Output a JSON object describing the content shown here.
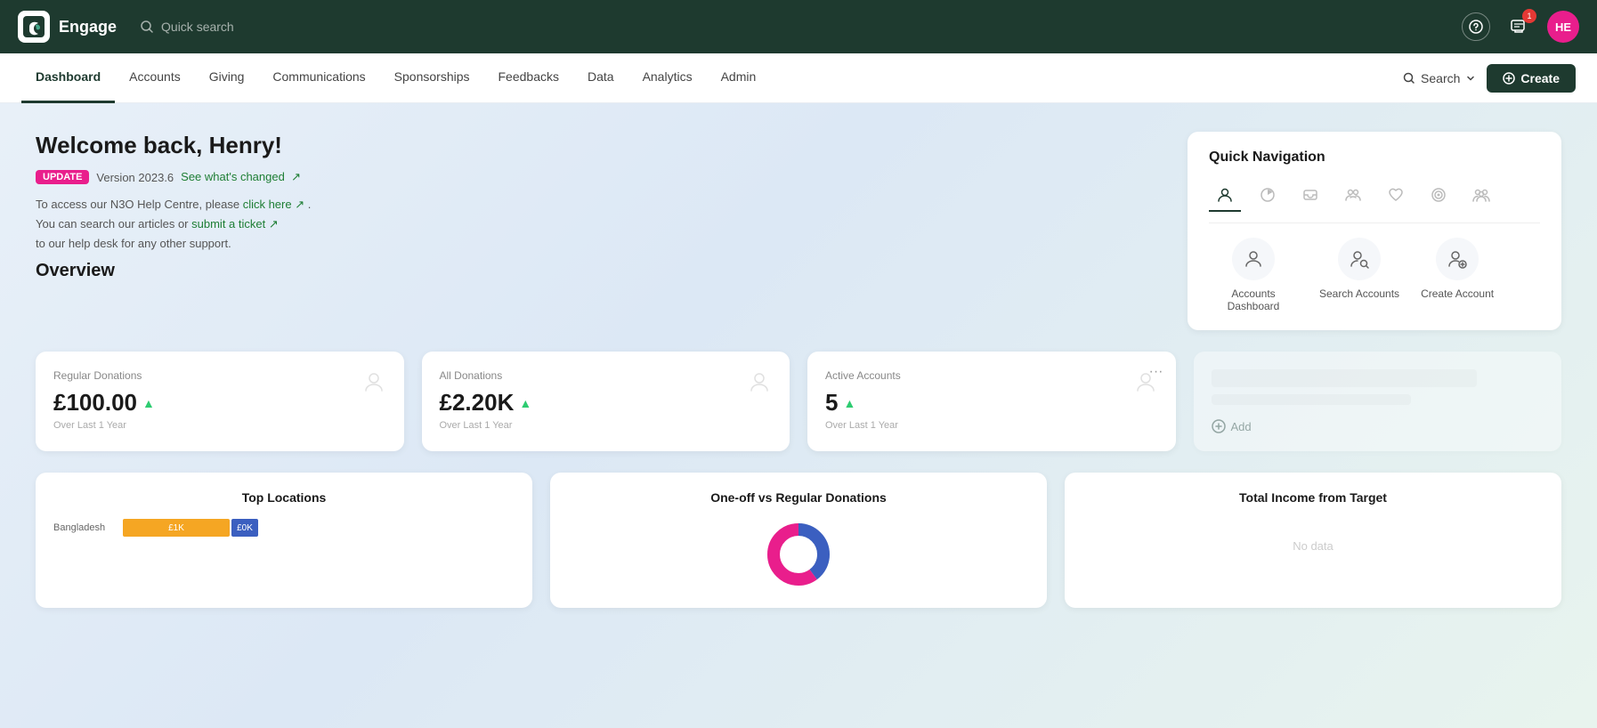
{
  "app": {
    "name": "Engage",
    "logo_initials": "E"
  },
  "topnav": {
    "search_placeholder": "Quick search",
    "notification_badge": "1",
    "avatar_initials": "HE"
  },
  "secnav": {
    "items": [
      {
        "label": "Dashboard",
        "active": true
      },
      {
        "label": "Accounts",
        "active": false
      },
      {
        "label": "Giving",
        "active": false
      },
      {
        "label": "Communications",
        "active": false
      },
      {
        "label": "Sponsorships",
        "active": false
      },
      {
        "label": "Feedbacks",
        "active": false
      },
      {
        "label": "Data",
        "active": false
      },
      {
        "label": "Analytics",
        "active": false
      },
      {
        "label": "Admin",
        "active": false
      }
    ],
    "search_label": "Search",
    "create_label": "Create"
  },
  "welcome": {
    "title": "Welcome back, Henry!",
    "update_tag": "UPDATE",
    "version": "Version 2023.6",
    "see_changes": "See what's changed",
    "help_line1": "To access our N3O Help Centre, please",
    "click_here": "click here",
    "help_line2": "You can search our articles or",
    "submit_ticket": "submit a ticket",
    "help_line3": "to our help desk for any other support."
  },
  "quick_nav": {
    "title": "Quick Navigation",
    "tab_icons": [
      "person",
      "chart",
      "inbox",
      "group",
      "heart",
      "target",
      "people"
    ],
    "actions": [
      {
        "label": "Accounts Dashboard",
        "icon": "person"
      },
      {
        "label": "Search Accounts",
        "icon": "search-person"
      },
      {
        "label": "Create Account",
        "icon": "add-person"
      }
    ]
  },
  "overview": {
    "title": "Overview",
    "cards": [
      {
        "label": "Regular Donations",
        "value": "£100.00",
        "trend": "up",
        "sub": "Over Last 1 Year",
        "has_more": false
      },
      {
        "label": "All Donations",
        "value": "£2.20K",
        "trend": "up",
        "sub": "Over Last 1 Year",
        "has_more": false
      },
      {
        "label": "Active Accounts",
        "value": "5",
        "trend": "up",
        "sub": "Over Last 1 Year",
        "has_more": true
      },
      {
        "label": "",
        "value": "",
        "trend": "",
        "sub": "",
        "has_more": false,
        "add_label": "Add",
        "is_empty": true
      }
    ]
  },
  "charts": [
    {
      "title": "Top Locations",
      "type": "bar",
      "rows": [
        {
          "label": "Bangladesh",
          "orange_w": 120,
          "blue_w": 10,
          "orange_label": "£1K",
          "blue_label": "£0K"
        }
      ]
    },
    {
      "title": "One-off vs Regular Donations",
      "type": "donut"
    },
    {
      "title": "Total Income from Target",
      "type": "progress"
    }
  ]
}
